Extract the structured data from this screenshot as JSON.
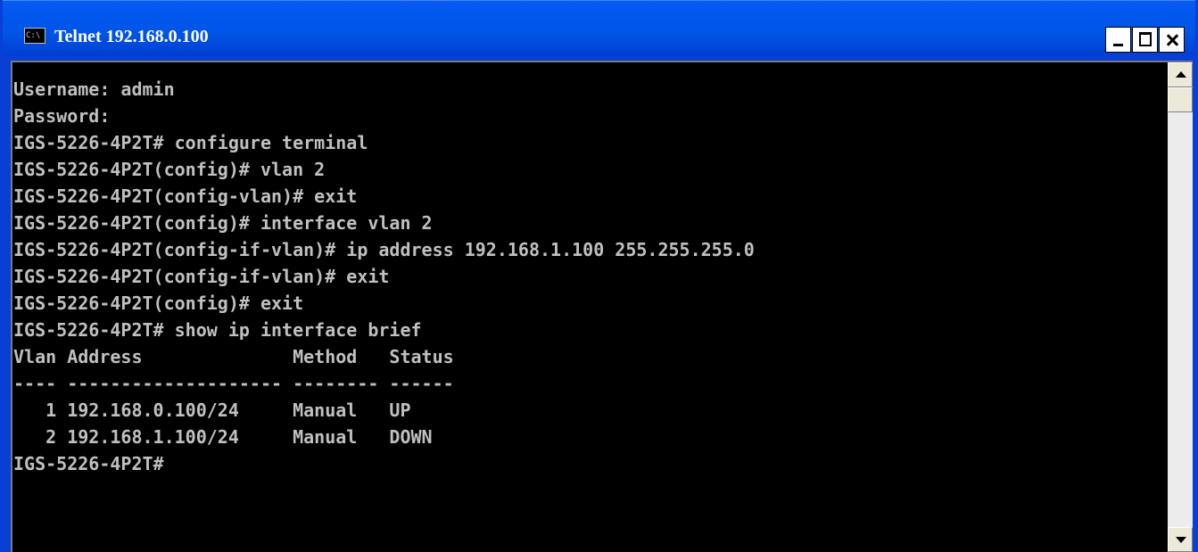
{
  "window": {
    "title": "Telnet 192.168.0.100",
    "icon_text": "C:\\",
    "icon": "console-icon",
    "controls": {
      "minimize_icon": "minimize-icon",
      "maximize_icon": "maximize-icon",
      "close_icon": "close-icon"
    },
    "colors": {
      "titlebar": "#0055e5",
      "terminal_background": "#000000",
      "terminal_text": "#c0c0c0"
    }
  },
  "terminal": {
    "lines": [
      "Username: admin",
      "Password:",
      "IGS-5226-4P2T# configure terminal",
      "IGS-5226-4P2T(config)# vlan 2",
      "IGS-5226-4P2T(config-vlan)# exit",
      "IGS-5226-4P2T(config)# interface vlan 2",
      "IGS-5226-4P2T(config-if-vlan)# ip address 192.168.1.100 255.255.255.0",
      "IGS-5226-4P2T(config-if-vlan)# exit",
      "IGS-5226-4P2T(config)# exit",
      "IGS-5226-4P2T# show ip interface brief",
      "Vlan Address              Method   Status",
      "---- -------------------- -------- ------",
      "   1 192.168.0.100/24     Manual   UP",
      "   2 192.168.1.100/24     Manual   DOWN",
      "IGS-5226-4P2T#"
    ]
  },
  "scrollbar": {
    "up_icon": "scroll-up-arrow-icon",
    "down_icon": "scroll-down-arrow-icon"
  }
}
